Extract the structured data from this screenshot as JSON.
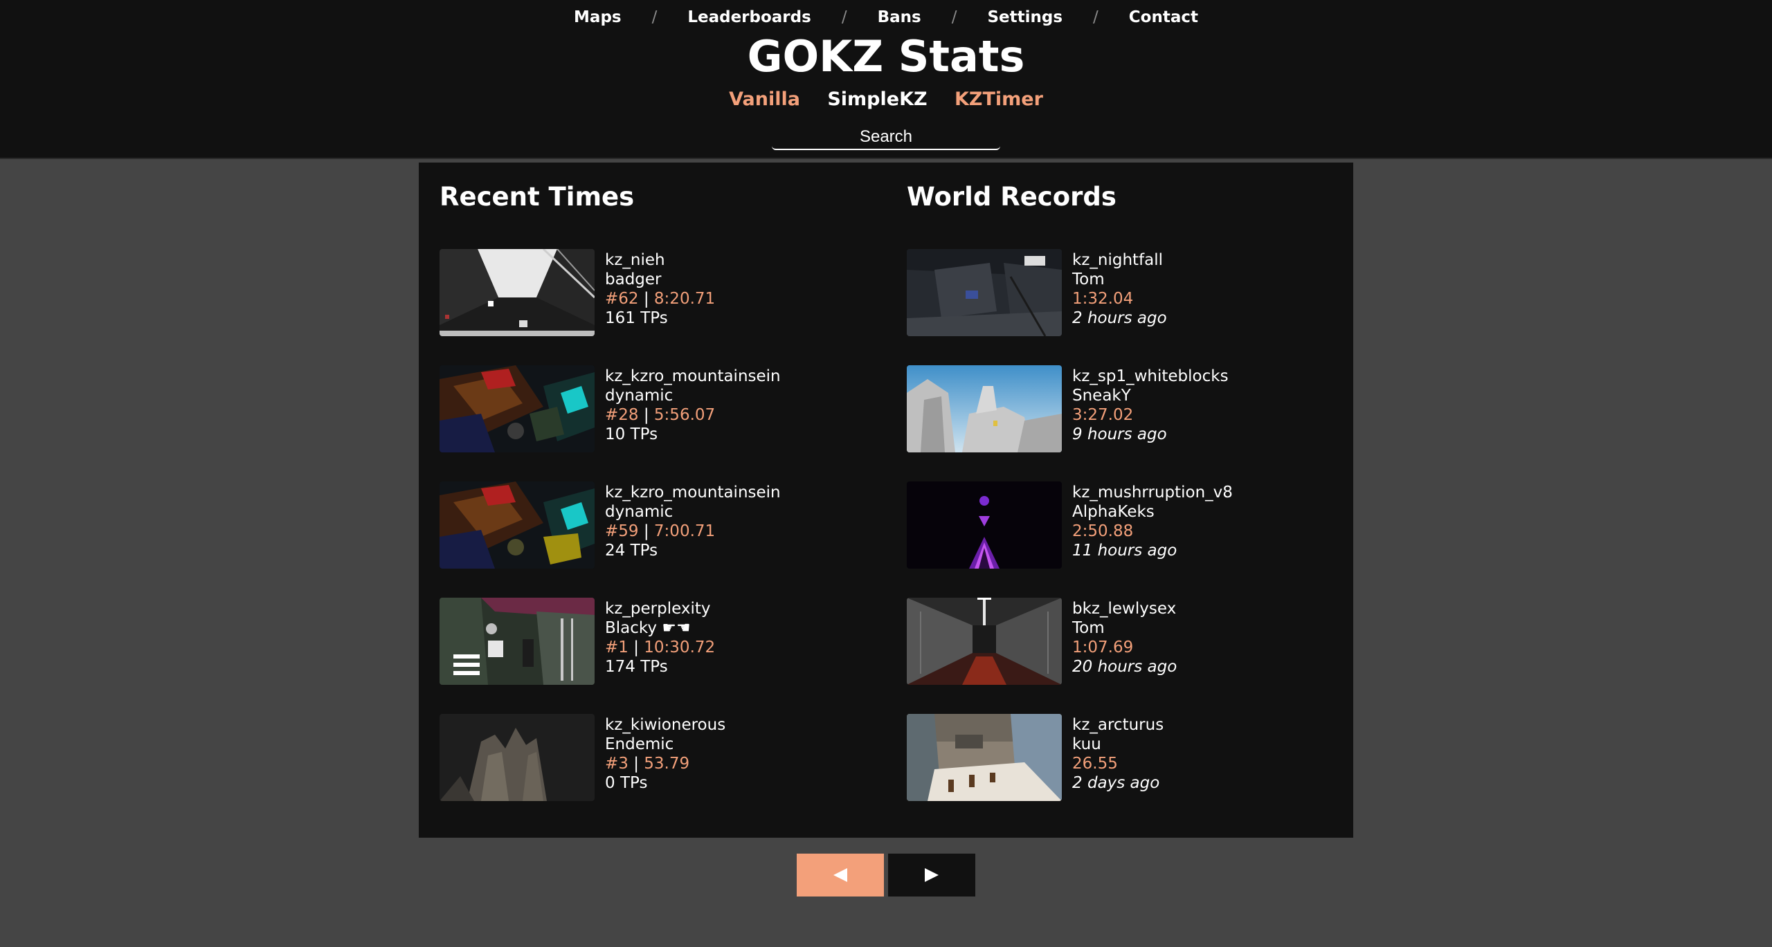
{
  "nav": {
    "items": [
      "Maps",
      "Leaderboards",
      "Bans",
      "Settings",
      "Contact"
    ],
    "separator": "/"
  },
  "site_title": "GOKZ Stats",
  "modes": {
    "vanilla": "Vanilla",
    "simplekz": "SimpleKZ",
    "kztimer": "KZTimer",
    "active": "SimpleKZ"
  },
  "search": {
    "placeholder": "Search"
  },
  "colors": {
    "accent": "#f3a07a",
    "header_bg": "#111111",
    "page_bg": "#454545"
  },
  "recent_times": {
    "title": "Recent Times",
    "entries": [
      {
        "map": "kz_nieh",
        "player": "badger",
        "rank": "#62",
        "sep": "|",
        "time": "8:20.71",
        "tps": "161 TPs"
      },
      {
        "map": "kz_kzro_mountainsein",
        "player": "dynamic",
        "rank": "#28",
        "sep": "|",
        "time": "5:56.07",
        "tps": "10 TPs"
      },
      {
        "map": "kz_kzro_mountainsein",
        "player": "dynamic",
        "rank": "#59",
        "sep": "|",
        "time": "7:00.71",
        "tps": "24 TPs"
      },
      {
        "map": "kz_perplexity",
        "player": "Blacky ☛☚",
        "rank": "#1",
        "sep": "|",
        "time": "10:30.72",
        "tps": "174 TPs"
      },
      {
        "map": "kz_kiwionerous",
        "player": "Endemic",
        "rank": "#3",
        "sep": "|",
        "time": "53.79",
        "tps": "0 TPs"
      }
    ]
  },
  "world_records": {
    "title": "World Records",
    "entries": [
      {
        "map": "kz_nightfall",
        "player": "Tom",
        "time": "1:32.04",
        "ago": "2 hours ago"
      },
      {
        "map": "kz_sp1_whiteblocks",
        "player": "SneakY",
        "time": "3:27.02",
        "ago": "9 hours ago"
      },
      {
        "map": "kz_mushrruption_v8",
        "player": "AlphaKeks",
        "time": "2:50.88",
        "ago": "11 hours ago"
      },
      {
        "map": "bkz_lewlysex",
        "player": "Tom",
        "time": "1:07.69",
        "ago": "20 hours ago"
      },
      {
        "map": "kz_arcturus",
        "player": "kuu",
        "time": "26.55",
        "ago": "2 days ago"
      }
    ]
  },
  "pager": {
    "prev_icon": "triangle-left-icon",
    "next_icon": "triangle-right-icon"
  }
}
